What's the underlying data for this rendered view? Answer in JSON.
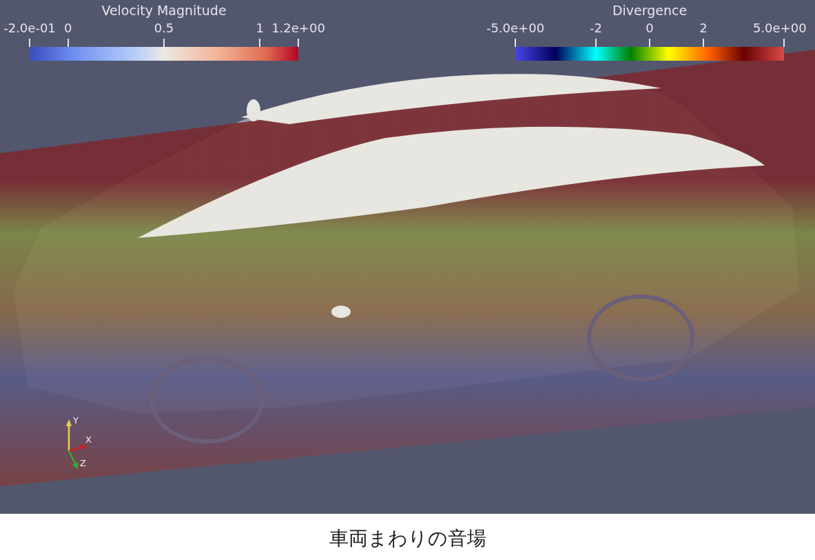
{
  "viewport": {
    "legends": [
      {
        "kind": "velocity",
        "title": "Velocity Magnitude",
        "ticks": [
          "-2.0e-01",
          "0",
          "0.5",
          "1",
          "1.2e+00"
        ]
      },
      {
        "kind": "divergence",
        "title": "Divergence",
        "ticks": [
          "-5.0e+00",
          "-2",
          "0",
          "2",
          "5.0e+00"
        ]
      }
    ],
    "axes": [
      "X",
      "Y",
      "Z"
    ]
  },
  "caption": "車両まわりの音場"
}
